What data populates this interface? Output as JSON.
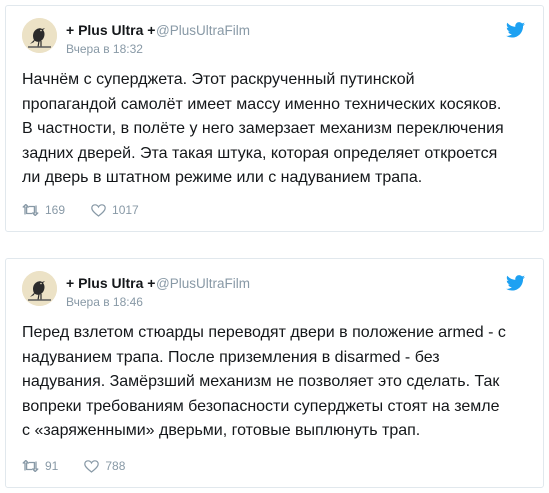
{
  "tweets": [
    {
      "author_name": "+ Plus Ultra +",
      "handle": "@PlusUltraFilm",
      "time": "Вчера в 18:32",
      "text_lines": [
        "Начнём с суперджета. Этот раскрученный путинской",
        "пропагандой самолёт имеет массу именно технических косяков.",
        "В частности, в полёте у него замерзает механизм переключения",
        "задних дверей. Эта такая штука, которая определяет откроется",
        "ли дверь в штатном режиме или с надуванием трапа."
      ],
      "retweets": "169",
      "likes": "1017"
    },
    {
      "author_name": "+ Plus Ultra +",
      "handle": "@PlusUltraFilm",
      "time": "Вчера в 18:46",
      "text_lines": [
        "Перед взлетом стюарды переводят двери в положение armed - с",
        "надуванием трапа. После приземления в disarmed - без",
        "надувания. Замёрзший механизм не позволяет это сделать. Так",
        "вопреки требованиям безопасности суперджеты стоят на земле",
        "с «заряженными» дверьми, готовые выплюнуть трап."
      ],
      "retweets": "91",
      "likes": "788"
    }
  ],
  "icons": {
    "brand": "twitter-bird-icon",
    "retweet": "retweet-icon",
    "like": "heart-icon",
    "avatar": "raven-avatar"
  },
  "colors": {
    "twitter_blue": "#1da1f2",
    "text": "#14171a",
    "muted": "#8899a6",
    "border": "#e1e8ed"
  }
}
